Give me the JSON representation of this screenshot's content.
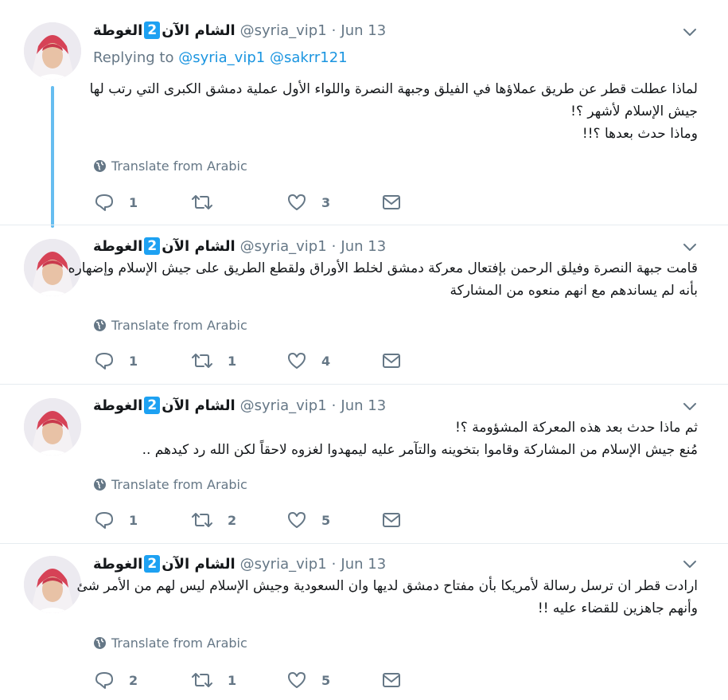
{
  "author": {
    "name_part1": "الشام الآن",
    "badge": "2",
    "name_part2": "الغوطة",
    "handle": "@syria_vip1",
    "separator": "·"
  },
  "translate_label": "Translate from Arabic",
  "tweets": [
    {
      "date": "Jun 13",
      "replying_prefix": "Replying to",
      "replying_users": [
        "@syria_vip1",
        "@sakrr121"
      ],
      "lines": [
        "لماذا عطلت قطر عن طريق عملاؤها في الفيلق وجبهة النصرة واللواء الأول عملية دمشق الكبرى التي رتب لها",
        "جيش الإسلام لأشهر  ؟!",
        "وماذا حدث بعدها ؟!!"
      ],
      "reply_count": "1",
      "retweet_count": "",
      "like_count": "3"
    },
    {
      "date": "Jun 13",
      "lines": [
        "قامت جبهة النصرة وفيلق الرحمن بإفتعال معركة دمشق لخلط الأوراق ولقطع الطريق على جيش الإسلام وإضهاره",
        "بأنه لم يساندهم مع انهم منعوه من المشاركة"
      ],
      "reply_count": "1",
      "retweet_count": "1",
      "like_count": "4"
    },
    {
      "date": "Jun 13",
      "lines": [
        "ثم ماذا حدث بعد هذه المعركة المشؤومة ؟!",
        "مُنع جيش الإسلام من المشاركة وقاموا بتخوينه والتآمر عليه ليمهدوا لغزوه لاحقاً لكن الله رد كيدهم .."
      ],
      "reply_count": "1",
      "retweet_count": "2",
      "like_count": "5"
    },
    {
      "date": "Jun 13",
      "lines": [
        "ارادت قطر ان ترسل رسالة لأمريكا بأن مفتاح دمشق لديها وان السعودية وجيش الإسلام ليس لهم من الأمر شئ",
        "وأنهم جاهزين للقضاء عليه !!"
      ],
      "reply_count": "2",
      "retweet_count": "1",
      "like_count": "5"
    }
  ],
  "colors": {
    "thread_line": "#66bdf0",
    "link": "#1b95e0",
    "badge": "#1da1f2",
    "muted": "#657786"
  },
  "icons": [
    "globe-icon",
    "reply-icon",
    "retweet-icon",
    "like-icon",
    "direct-message-icon",
    "chevron-down-icon"
  ]
}
